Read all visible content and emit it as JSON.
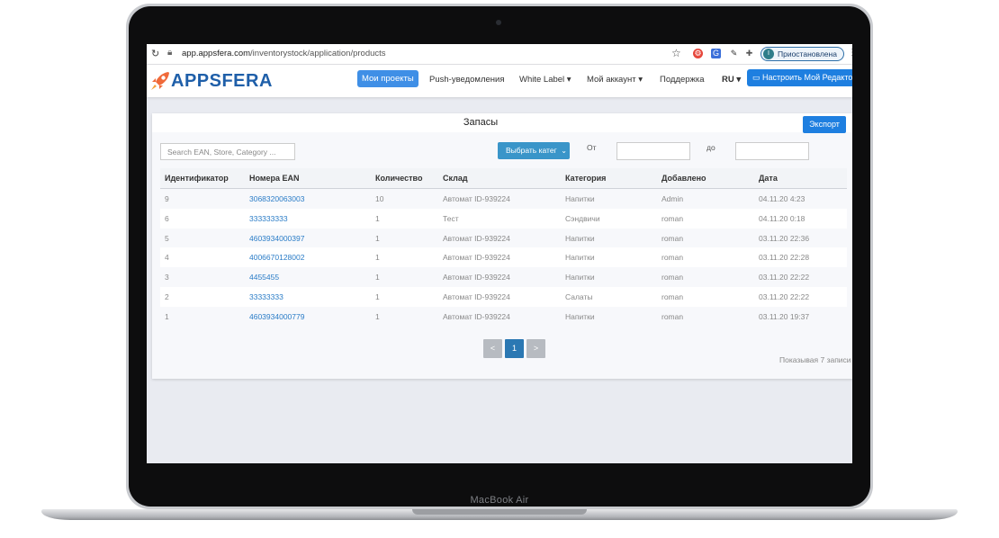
{
  "device": {
    "model_label": "MacBook Air"
  },
  "browser": {
    "url_host": "app.appsfera.com",
    "url_path": "/inventorystock/application/products",
    "profile_initial": "I",
    "profile_status": "Приостановлена"
  },
  "header": {
    "logo_text": "APPSFERA",
    "nav": [
      {
        "label": "Мои проекты"
      },
      {
        "label": "Push-уведомления"
      },
      {
        "label": "White Label ▾"
      },
      {
        "label": "Мой аккаунт ▾"
      },
      {
        "label": "Поддержка"
      },
      {
        "label": "RU ▾"
      }
    ],
    "cta_label": "Настроить Мой Редактор"
  },
  "page": {
    "title": "Запасы",
    "export_label": "Экспорт",
    "search_placeholder": "Search EAN, Store, Category ...",
    "category_select": "Выбрать катег",
    "from_label": "От",
    "to_label": "до"
  },
  "table": {
    "headers": [
      "Идентификатор",
      "Номера EAN",
      "Количество",
      "Склад",
      "Категория",
      "Добавлено",
      "Дата"
    ],
    "rows": [
      [
        "9",
        "3068320063003",
        "10",
        "Автомат ID-939224",
        "Напитки",
        "Admin",
        "04.11.20 4:23"
      ],
      [
        "6",
        "333333333",
        "1",
        "Тест",
        "Сэндвичи",
        "roman",
        "04.11.20 0:18"
      ],
      [
        "5",
        "4603934000397",
        "1",
        "Автомат ID-939224",
        "Напитки",
        "roman",
        "03.11.20 22:36"
      ],
      [
        "4",
        "4006670128002",
        "1",
        "Автомат ID-939224",
        "Напитки",
        "roman",
        "03.11.20 22:28"
      ],
      [
        "3",
        "4455455",
        "1",
        "Автомат ID-939224",
        "Напитки",
        "roman",
        "03.11.20 22:22"
      ],
      [
        "2",
        "33333333",
        "1",
        "Автомат ID-939224",
        "Салаты",
        "roman",
        "03.11.20 22:22"
      ],
      [
        "1",
        "4603934000779",
        "1",
        "Автомат ID-939224",
        "Напитки",
        "roman",
        "03.11.20 19:37"
      ]
    ]
  },
  "pagination": {
    "prev": "<",
    "current": "1",
    "next": ">",
    "info": "Показывая 7 записи"
  },
  "colors": {
    "accent": "#1e7fe0",
    "link": "#2a7cc7",
    "logo": "#1f5fa9"
  }
}
